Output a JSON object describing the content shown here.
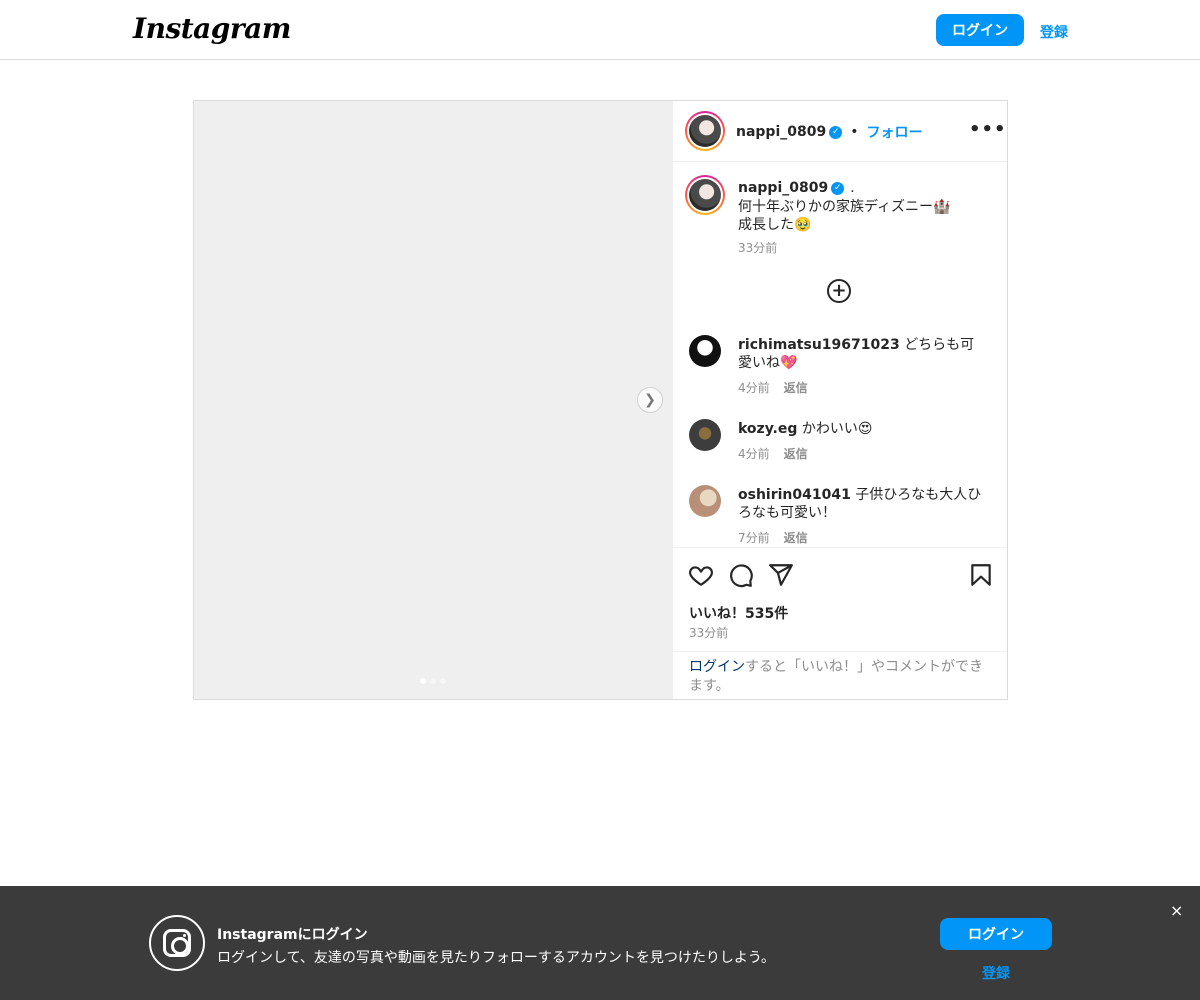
{
  "nav": {
    "logo": "Instagram",
    "login": "ログイン",
    "signup": "登録"
  },
  "post": {
    "username": "nappi_0809",
    "separator": "•",
    "follow": "フォロー",
    "more": "•••",
    "carousel": {
      "current": 1,
      "total": 3
    },
    "caption": {
      "username": "nappi_0809",
      "lines": [
        ".",
        "何十年ぶりかの家族ディズニー🏰",
        "成長した🥹"
      ],
      "time": "33分前"
    },
    "comments": [
      {
        "username": "richimatsu19671023",
        "text": "どちらも可愛いね💖",
        "time": "4分前",
        "reply": "返信"
      },
      {
        "username": "kozy.eg",
        "text": "かわいい😍",
        "time": "4分前",
        "reply": "返信"
      },
      {
        "username": "oshirin041041",
        "text": "子供ひろなも大人ひろなも可愛い！",
        "time": "7分前",
        "reply": "返信"
      }
    ],
    "likes": "いいね！535件",
    "time": "33分前",
    "login_prompt": {
      "link": "ログイン",
      "rest": "すると「いいね！」やコメントができます。"
    }
  },
  "banner": {
    "title": "Instagramにログイン",
    "subtitle": "ログインして、友達の写真や動画を見たりフォローするアカウントを見つけたりしよう。",
    "login": "ログイン",
    "signup": "登録",
    "close": "×"
  }
}
